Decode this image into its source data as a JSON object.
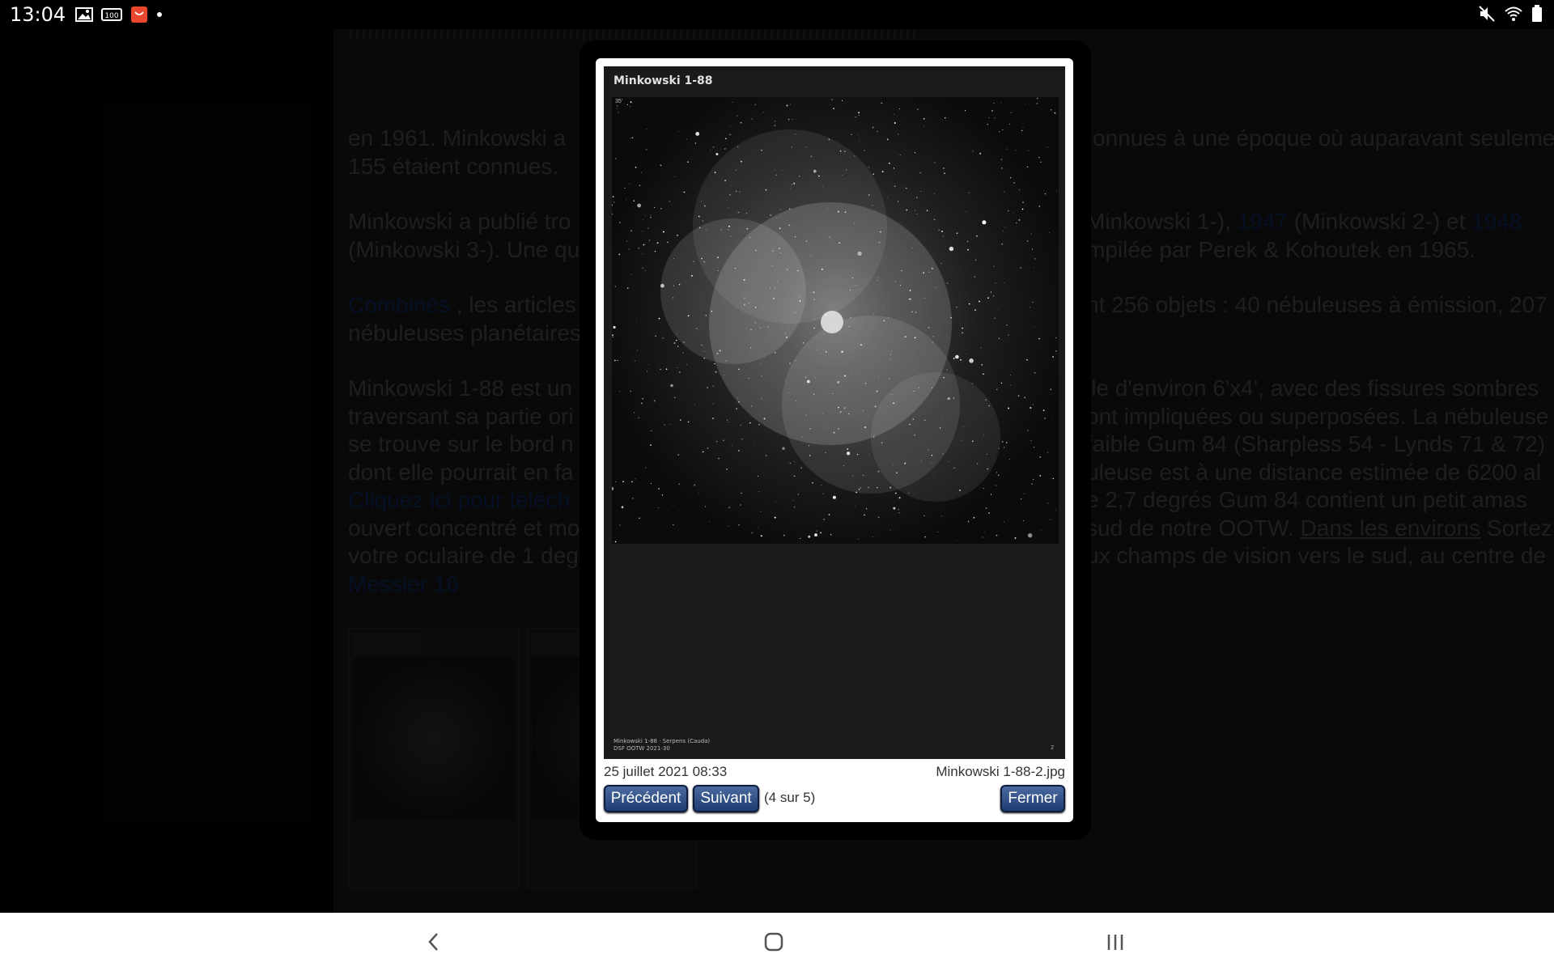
{
  "status_bar": {
    "time": "13:04",
    "left_icons": [
      "image-icon",
      "100-badge-icon",
      "shopping-bag-icon",
      "dot-icon"
    ],
    "right_icons": [
      "mute-icon",
      "wifi-icon",
      "battery-icon"
    ]
  },
  "article": {
    "lines": [
      [
        "en 1961. Minkowski a ",
        "onnues à une époque où auparavant seulement"
      ],
      [
        "155 étaient connues.",
        ""
      ],
      [
        "Minkowski a publié tro",
        "Minkowski 1-), ",
        "1947",
        " (Minkowski 2-) et ",
        "1948"
      ],
      [
        "(Minkowski 3-). Une qu",
        "mpilée par Perek & Kohoutek en 1965."
      ],
      [
        "Combinés",
        " , les articles",
        "nt 256 objets : 40 nébuleuses à émission, 207"
      ],
      [
        "nébuleuses planétaires",
        ""
      ],
      [
        "Minkowski 1-88 est un",
        "lle d'environ 6'x4', avec des fissures sombres"
      ],
      [
        "traversant sa partie ori",
        "ont impliquées ou superposées. La nébuleuse"
      ],
      [
        "se trouve sur le bord n",
        "faible Gum 84 (Sharpless 54 - Lynds 71 & 72)"
      ],
      [
        "dont elle pourrait en fa",
        "uleuse est à une distance estimée de 6200 al"
      ],
      [
        "Cliquez ici pour téléch",
        "e 2,7 degrés Gum 84 contient un petit amas"
      ],
      [
        "ouvert concentré et mo",
        " sud de notre OOTW. ",
        "Dans les environs",
        " Sortez"
      ],
      [
        "votre oculaire de 1 deg",
        "ux champs de vision vers le sud, au centre de"
      ],
      [
        "Messier 16",
        ""
      ]
    ]
  },
  "lightbox": {
    "image_title": "Minkowski 1-88",
    "footer_line1": "Minkowski 1-88 · Serpens (Cauda)",
    "footer_line2": "DSF OOTW 2021-30",
    "footer_page": "2",
    "corner_label": "35'",
    "date": "25 juillet 2021 08:33",
    "filename": "Minkowski 1-88-2.jpg",
    "prev_label": "Précédent",
    "next_label": "Suivant",
    "counter": "(4 sur 5)",
    "close_label": "Fermer"
  },
  "nav_bar": {
    "icons": [
      "back-icon",
      "home-icon",
      "recents-icon"
    ]
  },
  "colors": {
    "button_top": "#4a6aa0",
    "button_bottom": "#1d3d72",
    "article_text": "#2f2f2f",
    "article_link": "#0a1a3a"
  }
}
